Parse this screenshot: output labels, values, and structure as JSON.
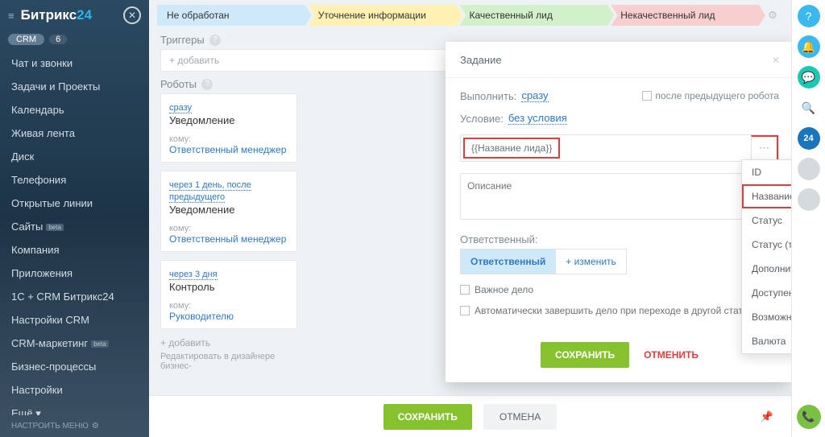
{
  "sidebar": {
    "logo_a": "Битрикс",
    "logo_b": "24",
    "crm_label": "CRM",
    "crm_count": "6",
    "items": [
      {
        "label": "Чат и звонки"
      },
      {
        "label": "Задачи и Проекты"
      },
      {
        "label": "Календарь"
      },
      {
        "label": "Живая лента"
      },
      {
        "label": "Диск"
      },
      {
        "label": "Телефония"
      },
      {
        "label": "Открытые линии"
      },
      {
        "label": "Сайты",
        "beta": "beta"
      },
      {
        "label": "Компания"
      },
      {
        "label": "Приложения"
      },
      {
        "label": "1С + CRM Битрикс24"
      },
      {
        "label": "Настройки CRM"
      },
      {
        "label": "CRM-маркетинг",
        "beta": "beta"
      },
      {
        "label": "Бизнес-процессы"
      },
      {
        "label": "Настройки"
      },
      {
        "label": "Ещё ▾"
      }
    ],
    "footer": "НАСТРОИТЬ МЕНЮ"
  },
  "stages": {
    "s1": "Не обработан",
    "s2": "Уточнение информации",
    "s3": "Качественный лид",
    "s4": "Некачественный лид"
  },
  "sections": {
    "triggers": "Триггеры",
    "robots": "Роботы",
    "add": "+ добавить",
    "add2": "вить",
    "footnote": "Редактировать в дизайнере бизнес-",
    "ghostnote": "ровать в дизайнере бизнес-"
  },
  "robots": [
    {
      "time": "сразу",
      "title": "Уведомление",
      "sub": "кому:",
      "link": "Ответственный менеджер"
    },
    {
      "time": "через 1 день, после предыдущего",
      "title": "Уведомление",
      "sub": "кому:",
      "link": "Ответственный менеджер"
    },
    {
      "time": "через 3 дня",
      "title": "Контроль",
      "sub": "кому:",
      "link": "Руководителю"
    }
  ],
  "modal": {
    "title": "Задание",
    "exec_lbl": "Выполнить:",
    "exec_val": "сразу",
    "after_chk": "после предыдущего робота",
    "cond_lbl": "Условие:",
    "cond_val": "без условия",
    "field_val": "{{Название лида}}",
    "desc_ph": "Описание",
    "resp_lbl": "Ответственный:",
    "resp_chip": "Ответственный",
    "resp_change": "+ изменить",
    "chk1": "Важное дело",
    "chk2": "Автоматически завершить дело при переходе в другой статус",
    "save": "СОХРАНИТЬ",
    "cancel": "ОТМЕНИТЬ"
  },
  "dropdown": {
    "items": [
      "ID",
      "Название лида",
      "Статус",
      "Статус (текст)",
      "Дополнительно о статусе",
      "Доступен для всех",
      "Возможная сумма сделки",
      "Валюта"
    ]
  },
  "bottombar": {
    "save": "СОХРАНИТЬ",
    "cancel": "ОТМЕНА"
  },
  "rail": {
    "b24": "24"
  }
}
